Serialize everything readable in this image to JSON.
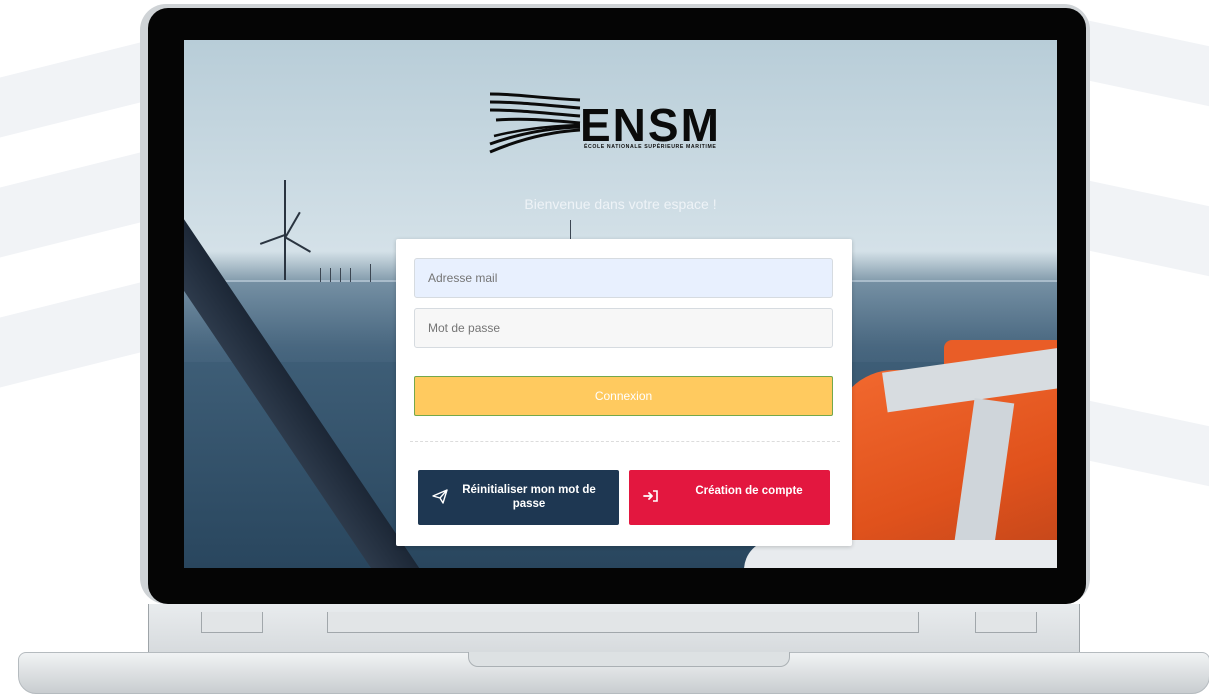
{
  "logo": {
    "name": "ENSM",
    "subtitle": "ÉCOLE NATIONALE SUPÉRIEURE MARITIME"
  },
  "welcome_text": "Bienvenue dans votre espace !",
  "form": {
    "email_placeholder": "Adresse mail",
    "password_placeholder": "Mot de passe",
    "login_label": "Connexion"
  },
  "actions": {
    "reset_label": "Réinitialiser mon mot de passe",
    "reset_icon": "paper-plane-icon",
    "create_label": "Création de compte",
    "create_icon": "sign-in-icon"
  },
  "colors": {
    "login_button": "#ffca5f",
    "reset_button": "#1e3752",
    "create_button": "#e3173f"
  }
}
